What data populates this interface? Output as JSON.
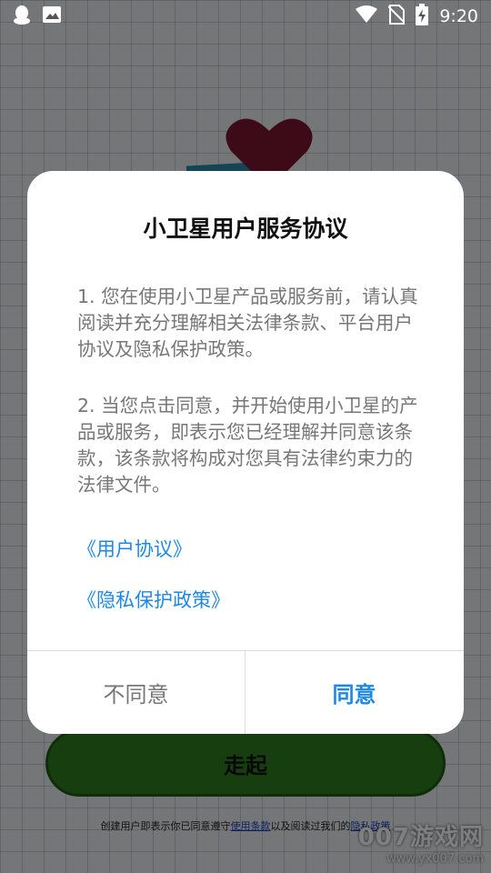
{
  "status_bar": {
    "time": "9:20",
    "left_icons": [
      "qq-icon",
      "image-icon"
    ],
    "right_icons": [
      "wifi-icon",
      "no-sim-icon",
      "battery-charging-icon"
    ]
  },
  "background": {
    "go_button_label": "走起",
    "note": {
      "prefix": "创建用户即表示你已同意遵守",
      "terms_link": "使用条款",
      "middle": "以及阅读过我们的",
      "privacy_link": "隐私政策"
    },
    "colors": {
      "go_button": "#2f7d1e",
      "heart": "#7a1530"
    }
  },
  "dialog": {
    "title": "小卫星用户服务协议",
    "paragraphs": [
      "1. 您在使用小卫星产品或服务前，请认真阅读并充分理解相关法律条款、平台用户协议及隐私保护政策。",
      "2. 当您点击同意，并开始使用小卫星的产品或服务，即表示您已经理解并同意该条款，该条款将构成对您具有法律约束力的法律文件。"
    ],
    "links": [
      "《用户协议》",
      "《隐私保护政策》"
    ],
    "buttons": {
      "disagree": "不同意",
      "agree": "同意"
    },
    "colors": {
      "link": "#1e88e5",
      "body_text": "#777777"
    }
  },
  "watermark": {
    "line1": "007游戏网",
    "line2": "www.yx007.com"
  }
}
